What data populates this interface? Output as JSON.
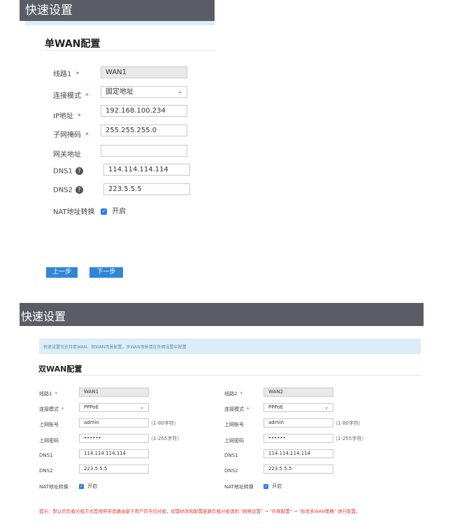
{
  "top": {
    "title": "快速设置",
    "section_title": "单WAN配置",
    "fields": [
      {
        "label": "线路1",
        "required": true,
        "value": "WAN1"
      },
      {
        "label": "连接模式",
        "required": true,
        "value": "固定地址"
      },
      {
        "label": "IP地址",
        "required": true,
        "value": "192.168.100.234"
      },
      {
        "label": "子网掩码",
        "required": true,
        "value": "255.255.255.0"
      },
      {
        "label": "网关地址",
        "required": false,
        "value": ""
      },
      {
        "label": "DNS1",
        "value": "114.114.114.114"
      },
      {
        "label": "DNS2",
        "value": "223.5.5.5"
      }
    ],
    "nat": {
      "label": "NAT地址转换",
      "option": "开启"
    },
    "prev_button": "上一步",
    "next_button": "下一步"
  },
  "bottom": {
    "title": "快速设置",
    "notice": "快速设置仅支持单WAN、双WAN场景配置，多WAN场景请在外网设置中配置",
    "section_title": "双WAN配置",
    "left": {
      "line_label": "线路1",
      "line_value": "WAN1",
      "mode_label": "连接模式",
      "mode_value": "PPPoE",
      "account_label": "上网账号",
      "account_value": "admin",
      "account_hint": "（1-80字符）",
      "password_label": "上网密码",
      "password_value": "••••••",
      "password_hint": "（1-255字符）",
      "dns1_label": "DNS1",
      "dns1_value": "114.114.114.114",
      "dns2_label": "DNS2",
      "dns2_value": "223.5.5.5",
      "nat_label": "NAT地址转换",
      "nat_option": "开启"
    },
    "right": {
      "line_label": "线路2",
      "line_value": "WAN2",
      "mode_label": "连接模式",
      "mode_value": "PPPoE",
      "account_label": "上网账号",
      "account_value": "admin",
      "account_hint": "（1-80字符）",
      "password_label": "上网密码",
      "password_value": "••••••",
      "password_hint": "（1-255字符）",
      "dns1_label": "DNS1",
      "dns1_value": "114.114.114.114",
      "dns2_label": "DNS2",
      "dns2_value": "223.5.5.5",
      "nat_label": "NAT地址转换",
      "nat_option": "开启"
    },
    "warning": "提示：默认的负载分担方式是按照带宽路由基于用户的平均分担，如需修改和配置链路负载分担请到 \"网络设置\" → \"外网配置\" → \"修改多WAN策略\" 进行配置。"
  }
}
